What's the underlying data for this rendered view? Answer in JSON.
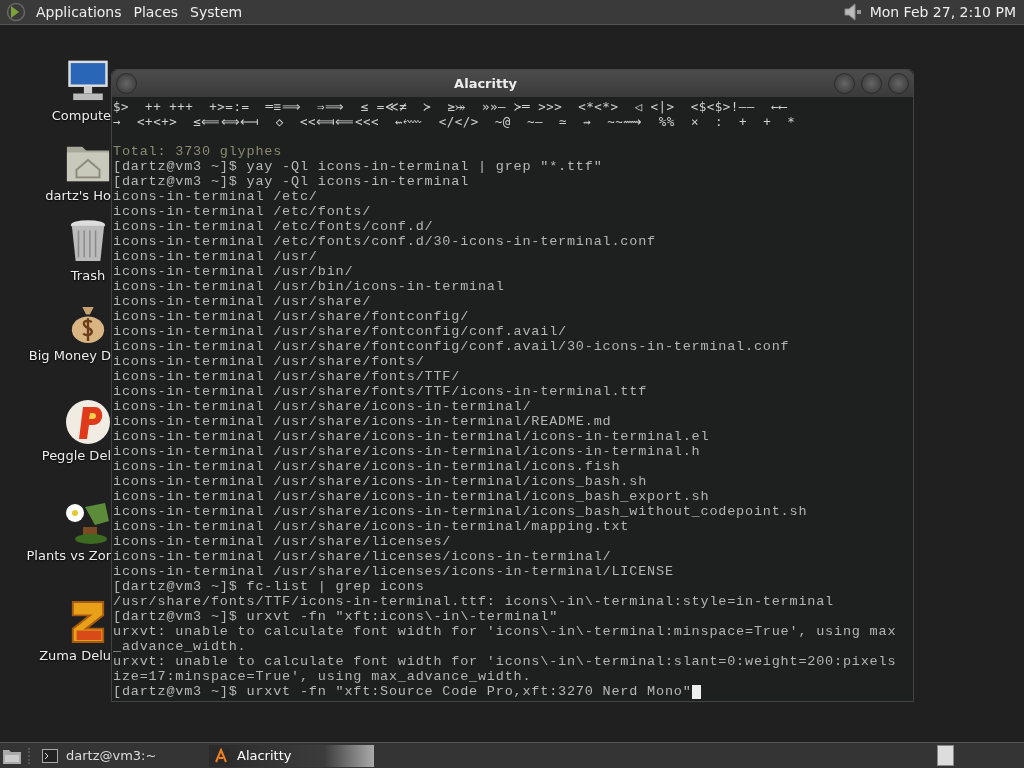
{
  "top_panel": {
    "menus": [
      "Applications",
      "Places",
      "System"
    ],
    "clock": "Mon Feb 27,  2:10 PM"
  },
  "desktop_icons": [
    {
      "label": "Compute",
      "kind": "computer"
    },
    {
      "label": "dartz's Ho",
      "kind": "home"
    },
    {
      "label": "Trash",
      "kind": "trash"
    },
    {
      "label": "Big Money D",
      "kind": "money"
    },
    {
      "label": "Peggle Del",
      "kind": "peggle"
    },
    {
      "label": "Plants vs Zor",
      "kind": "plants"
    },
    {
      "label": "Zuma Delu",
      "kind": "zuma"
    }
  ],
  "window": {
    "title": "Alacritty",
    "lines": [
      {
        "text": "$>  ++ +++  +>=:=  ═≡⟹  ⇒⟹  ≤ =≪≠  ≻  ≥⤖  »»— ≻═ >>>  <*<*>  ◁ <|>  <$<$>!——  ←⟵",
        "kind": "glyph"
      },
      {
        "text": "→  <+<+>  ≤⟸⟺⟻  ◇  <<⟽⟸<<<  ⇜⬳  </</>  ~@  ~–  ≃  ⇝  ~~⟿  %%  ×  :  +  +  *",
        "kind": "glyph"
      },
      {
        "kind": "blank"
      },
      {
        "text": "Total: 3730 glyphes",
        "kind": "dim"
      },
      {
        "text": "[dartz@vm3 ~]$ yay -Ql icons-in-terminal | grep \"*.ttf\"",
        "kind": "prompt"
      },
      {
        "text": "[dartz@vm3 ~]$ yay -Ql icons-in-terminal",
        "kind": "prompt"
      },
      {
        "text": "icons-in-terminal /etc/",
        "kind": "output"
      },
      {
        "text": "icons-in-terminal /etc/fonts/",
        "kind": "output"
      },
      {
        "text": "icons-in-terminal /etc/fonts/conf.d/",
        "kind": "output"
      },
      {
        "text": "icons-in-terminal /etc/fonts/conf.d/30-icons-in-terminal.conf",
        "kind": "output"
      },
      {
        "text": "icons-in-terminal /usr/",
        "kind": "output"
      },
      {
        "text": "icons-in-terminal /usr/bin/",
        "kind": "output"
      },
      {
        "text": "icons-in-terminal /usr/bin/icons-in-terminal",
        "kind": "output"
      },
      {
        "text": "icons-in-terminal /usr/share/",
        "kind": "output"
      },
      {
        "text": "icons-in-terminal /usr/share/fontconfig/",
        "kind": "output"
      },
      {
        "text": "icons-in-terminal /usr/share/fontconfig/conf.avail/",
        "kind": "output"
      },
      {
        "text": "icons-in-terminal /usr/share/fontconfig/conf.avail/30-icons-in-terminal.conf",
        "kind": "output"
      },
      {
        "text": "icons-in-terminal /usr/share/fonts/",
        "kind": "output"
      },
      {
        "text": "icons-in-terminal /usr/share/fonts/TTF/",
        "kind": "output"
      },
      {
        "text": "icons-in-terminal /usr/share/fonts/TTF/icons-in-terminal.ttf",
        "kind": "output"
      },
      {
        "text": "icons-in-terminal /usr/share/icons-in-terminal/",
        "kind": "output"
      },
      {
        "text": "icons-in-terminal /usr/share/icons-in-terminal/README.md",
        "kind": "output"
      },
      {
        "text": "icons-in-terminal /usr/share/icons-in-terminal/icons-in-terminal.el",
        "kind": "output"
      },
      {
        "text": "icons-in-terminal /usr/share/icons-in-terminal/icons-in-terminal.h",
        "kind": "output"
      },
      {
        "text": "icons-in-terminal /usr/share/icons-in-terminal/icons.fish",
        "kind": "output"
      },
      {
        "text": "icons-in-terminal /usr/share/icons-in-terminal/icons_bash.sh",
        "kind": "output"
      },
      {
        "text": "icons-in-terminal /usr/share/icons-in-terminal/icons_bash_export.sh",
        "kind": "output"
      },
      {
        "text": "icons-in-terminal /usr/share/icons-in-terminal/icons_bash_without_codepoint.sh",
        "kind": "output"
      },
      {
        "text": "icons-in-terminal /usr/share/icons-in-terminal/mapping.txt",
        "kind": "output"
      },
      {
        "text": "icons-in-terminal /usr/share/licenses/",
        "kind": "output"
      },
      {
        "text": "icons-in-terminal /usr/share/licenses/icons-in-terminal/",
        "kind": "output"
      },
      {
        "text": "icons-in-terminal /usr/share/licenses/icons-in-terminal/LICENSE",
        "kind": "output"
      },
      {
        "text": "[dartz@vm3 ~]$ fc-list | grep icons",
        "kind": "prompt"
      },
      {
        "text": "/usr/share/fonts/TTF/icons-in-terminal.ttf: icons\\-in\\-terminal:style=in-terminal",
        "kind": "output"
      },
      {
        "text": "[dartz@vm3 ~]$ urxvt -fn \"xft:icons\\-in\\-terminal\"",
        "kind": "prompt"
      },
      {
        "text": "urxvt: unable to calculate font width for 'icons\\-in\\-terminal:minspace=True', using max",
        "kind": "output"
      },
      {
        "text": "_advance_width.",
        "kind": "output"
      },
      {
        "text": "urxvt: unable to calculate font width for 'icons\\-in\\-terminal:slant=0:weight=200:pixels",
        "kind": "output"
      },
      {
        "text": "ize=17:minspace=True', using max_advance_width.",
        "kind": "output"
      },
      {
        "text": "[dartz@vm3 ~]$ urxvt -fn \"xft:Source Code Pro,xft:3270 Nerd Mono\"",
        "kind": "prompt",
        "cursor": true
      }
    ]
  },
  "taskbar": {
    "tasks": [
      {
        "label": "dartz@vm3:~",
        "kind": "terminal",
        "selected": false
      },
      {
        "label": "Alacritty",
        "kind": "alacritty",
        "selected": true
      }
    ]
  }
}
